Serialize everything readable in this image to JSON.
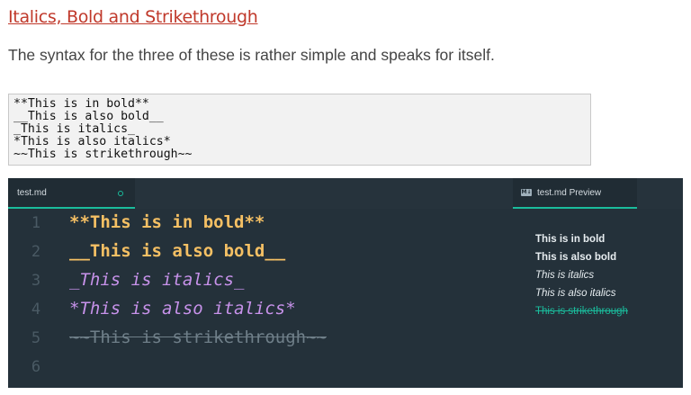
{
  "heading": "Italics, Bold and Strikethrough",
  "intro": "The syntax for the three of these is rather simple and speaks for itself.",
  "code_example": [
    "**This is in bold**",
    "__This is also bold__",
    "_This is italics_",
    "*This is also italics*",
    "~~This is strikethrough~~"
  ],
  "editor": {
    "tab_file": "test.md",
    "tab_preview": "test.md Preview",
    "preview_icon": "M↓",
    "line_numbers": [
      "1",
      "2",
      "3",
      "4",
      "5",
      "6"
    ],
    "lines": [
      "**This is in bold**",
      "__This is also bold__",
      "_This is italics_",
      "*This is also italics*",
      "~~This is strikethrough~~"
    ],
    "preview_lines": [
      "This is in bold",
      "This is also bold",
      "This is italics",
      "This is also italics",
      "This is strikethrough"
    ],
    "colors": {
      "background": "#24313a",
      "accent": "#1abc9c",
      "bold": "#f5c064",
      "italic": "#c792ea",
      "strike": "#6f7f89"
    }
  }
}
